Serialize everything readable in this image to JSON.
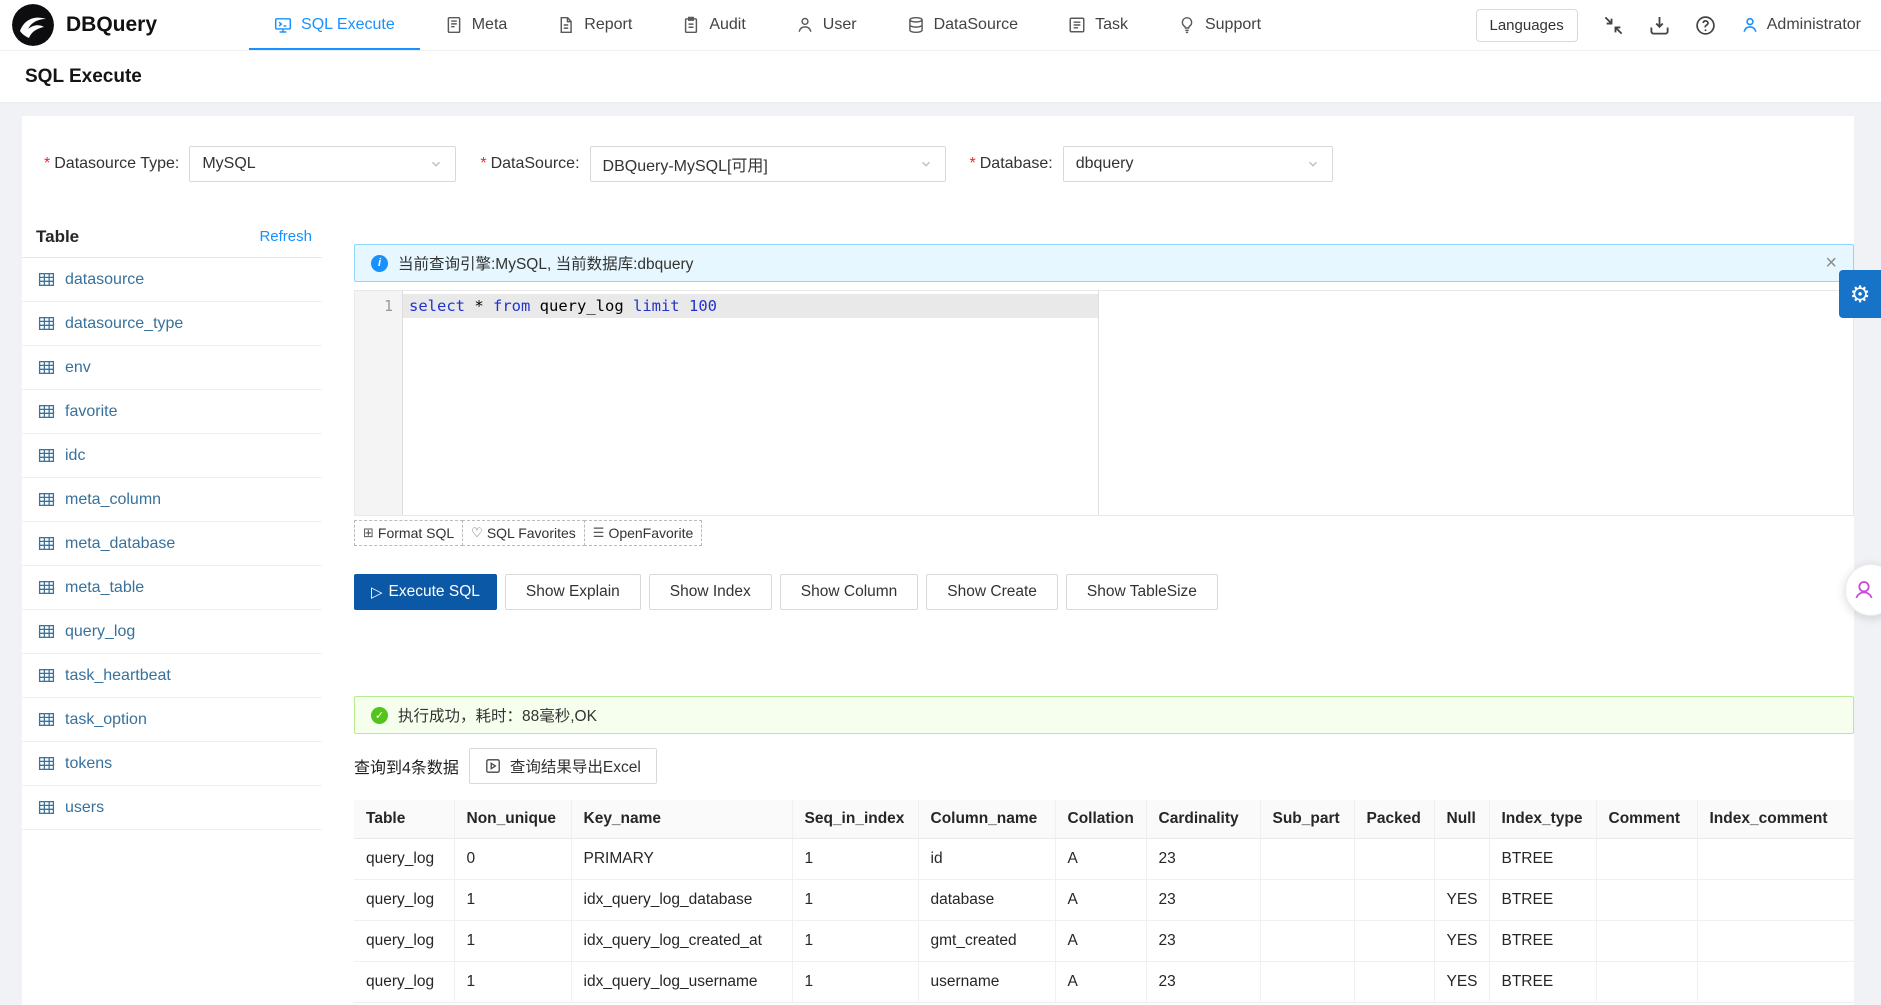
{
  "app": {
    "title": "DBQuery"
  },
  "colors": {
    "accent": "#1890ff",
    "primary_button": "#0a58a6",
    "info_bg": "#e6f7ff",
    "info_border": "#91d5ff",
    "success_bg": "#f6ffed",
    "success_border": "#b7eb8f",
    "success_icon": "#52c41a",
    "gear_button": "#1673c8"
  },
  "icons": {
    "close": "×",
    "gear": "⚙",
    "play": "▷",
    "heart": "♡",
    "menu": "☰",
    "grid": "⊞",
    "info": "i",
    "check": "✓"
  },
  "nav": {
    "items": [
      {
        "label": "SQL Execute",
        "icon": "console",
        "active": true
      },
      {
        "label": "Meta",
        "icon": "book",
        "active": false
      },
      {
        "label": "Report",
        "icon": "file",
        "active": false
      },
      {
        "label": "Audit",
        "icon": "clipboard",
        "active": false
      },
      {
        "label": "User",
        "icon": "user",
        "active": false
      },
      {
        "label": "DataSource",
        "icon": "database",
        "active": false
      },
      {
        "label": "Task",
        "icon": "tasklist",
        "active": false
      },
      {
        "label": "Support",
        "icon": "bulb",
        "active": false
      }
    ],
    "languages_label": "Languages",
    "user_name": "Administrator"
  },
  "page": {
    "title": "SQL Execute"
  },
  "form": {
    "datasource_type": {
      "label": "Datasource Type:",
      "value": "MySQL"
    },
    "datasource": {
      "label": "DataSource:",
      "value": "DBQuery-MySQL[可用]"
    },
    "database": {
      "label": "Database:",
      "value": "dbquery"
    }
  },
  "sidebar": {
    "title": "Table",
    "refresh_label": "Refresh",
    "tables": [
      "datasource",
      "datasource_type",
      "env",
      "favorite",
      "idc",
      "meta_column",
      "meta_database",
      "meta_table",
      "query_log",
      "task_heartbeat",
      "task_option",
      "tokens",
      "users"
    ]
  },
  "editor": {
    "info_alert": "当前查询引擎:MySQL, 当前数据库:dbquery",
    "line_number": "1",
    "sql": "select * from query_log limit 100",
    "tokens": [
      {
        "text": "select",
        "type": "keyword"
      },
      {
        "text": " * ",
        "type": "plain"
      },
      {
        "text": "from",
        "type": "keyword"
      },
      {
        "text": " query_log ",
        "type": "plain"
      },
      {
        "text": "limit",
        "type": "keyword"
      },
      {
        "text": " 100",
        "type": "number"
      }
    ],
    "toolbar": [
      {
        "label": "Format SQL",
        "icon": "grid"
      },
      {
        "label": "SQL Favorites",
        "icon": "heart"
      },
      {
        "label": "OpenFavorite",
        "icon": "menu"
      }
    ]
  },
  "actions": {
    "execute_label": "Execute SQL",
    "buttons": [
      "Show Explain",
      "Show Index",
      "Show Column",
      "Show Create",
      "Show TableSize"
    ]
  },
  "result": {
    "success_message": "执行成功，耗时：88毫秒,OK",
    "count_text": "查询到4条数据",
    "export_label": "查询结果导出Excel",
    "table": {
      "columns": [
        "Table",
        "Non_unique",
        "Key_name",
        "Seq_in_index",
        "Column_name",
        "Collation",
        "Cardinality",
        "Sub_part",
        "Packed",
        "Null",
        "Index_type",
        "Comment",
        "Index_comment"
      ],
      "rows": [
        [
          "query_log",
          "0",
          "PRIMARY",
          "1",
          "id",
          "A",
          "23",
          "",
          "",
          "",
          "BTREE",
          "",
          ""
        ],
        [
          "query_log",
          "1",
          "idx_query_log_database",
          "1",
          "database",
          "A",
          "23",
          "",
          "",
          "YES",
          "BTREE",
          "",
          ""
        ],
        [
          "query_log",
          "1",
          "idx_query_log_created_at",
          "1",
          "gmt_created",
          "A",
          "23",
          "",
          "",
          "YES",
          "BTREE",
          "",
          ""
        ],
        [
          "query_log",
          "1",
          "idx_query_log_username",
          "1",
          "username",
          "A",
          "23",
          "",
          "",
          "YES",
          "BTREE",
          "",
          ""
        ]
      ]
    }
  }
}
